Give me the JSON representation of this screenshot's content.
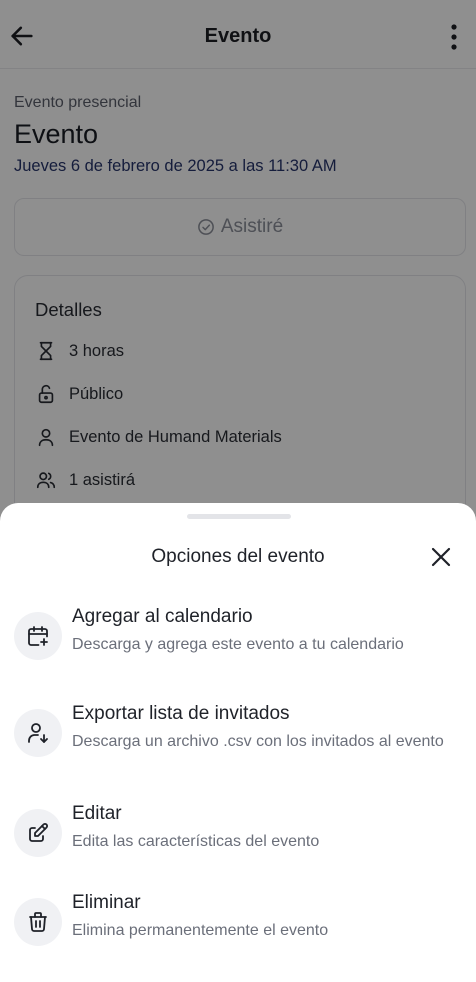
{
  "header": {
    "title": "Evento",
    "back_icon": "arrow-left-icon",
    "more_icon": "more-vertical-icon"
  },
  "event": {
    "type": "Evento presencial",
    "title": "Evento",
    "date": "Jueves 6 de febrero de 2025 a las 11:30 AM",
    "attend_label": "Asistiré"
  },
  "details": {
    "title": "Detalles",
    "duration": "3 horas",
    "visibility": "Público",
    "organizer": "Evento de Humand Materials",
    "attendees": "1 asistirá"
  },
  "sheet": {
    "title": "Opciones del evento",
    "close_icon": "close-icon",
    "options": [
      {
        "icon": "calendar-plus-icon",
        "title": "Agregar al calendario",
        "description": "Descarga y agrega este evento a tu calendario"
      },
      {
        "icon": "user-download-icon",
        "title": "Exportar lista de invitados",
        "description": "Descarga un archivo .csv con los invitados al evento"
      },
      {
        "icon": "edit-icon",
        "title": "Editar",
        "description": "Edita las características del evento"
      },
      {
        "icon": "trash-icon",
        "title": "Eliminar",
        "description": "Elimina permanentemente el evento"
      }
    ]
  },
  "colors": {
    "overlay": "#000000",
    "date_link": "#27346b",
    "icon_circle": "#f0f1f4"
  }
}
